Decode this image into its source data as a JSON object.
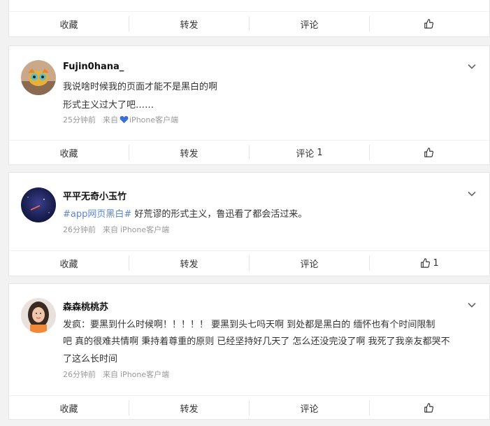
{
  "actions": {
    "collect": "收藏",
    "forward": "转发",
    "comment": "评论"
  },
  "posts": [
    {
      "username": "Fujin0hana_",
      "lines": [
        "我说啥时候我的页面才能不是黑白的啊",
        "形式主义过大了吧……"
      ],
      "time": "25分钟前",
      "source_prefix": "来自",
      "source": "iPhone客户端",
      "comment_count": "1",
      "like_count": ""
    },
    {
      "username": "平平无奇小玉竹",
      "topic": "#app网页黑白#",
      "text": " 好荒谬的形式主义，鲁迅看了都会活过来。",
      "time": "26分钟前",
      "source_prefix": "来自",
      "source": "iPhone客户端",
      "comment_count": "",
      "like_count": "1"
    },
    {
      "username": "森森桃桃苏",
      "lines": [
        "发疯：要黑到什么时候啊！！！！！ 要黑到头七吗天啊 到处都是黑白的 缅怀也有个时间限制",
        "吧 真的很难共情啊 秉持着尊重的原则 已经坚持好几天了 怎么还没完没了啊 我死了我亲友都哭不",
        "了这么长时间"
      ],
      "time": "26分钟前",
      "source_prefix": "来自",
      "source": "iPhone客户端",
      "comment_count": "",
      "like_count": ""
    }
  ],
  "colors": {
    "topic": "#5c85d6",
    "heart": "#3b6fd6",
    "meta": "#999999"
  }
}
